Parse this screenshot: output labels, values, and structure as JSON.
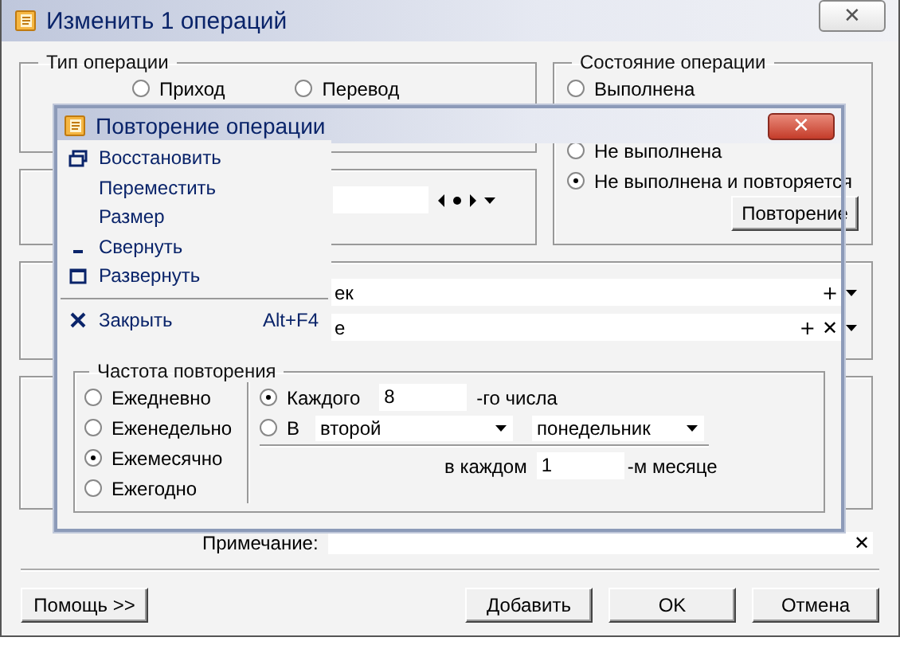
{
  "main_window": {
    "title": "Изменить 1 операций",
    "close": "✕",
    "operation_type": {
      "title": "Тип операции",
      "options": [
        {
          "label": "Приход",
          "selected": false
        },
        {
          "label": "Перевод",
          "selected": false
        }
      ]
    },
    "operation_state": {
      "title": "Состояние операции",
      "options": [
        {
          "label": "Выполнена",
          "selected": false
        },
        {
          "label": "Не выполнена",
          "selected": false
        },
        {
          "label": "Не выполнена и повторяется",
          "selected": true
        }
      ],
      "button": "Повторение"
    },
    "fields": [
      {
        "value": "ек",
        "buttons": [
          "+"
        ]
      },
      {
        "value": "е",
        "buttons": [
          "+",
          "✕"
        ]
      }
    ],
    "note": {
      "label": "Примечание:",
      "clear": "✕"
    },
    "buttons": [
      "Помощь >>",
      "Добавить",
      "OK",
      "Отмена"
    ]
  },
  "repeat_dialog": {
    "title": "Повторение операции",
    "close": "✕",
    "system_menu": [
      {
        "kind": "restore",
        "label": "Восстановить"
      },
      {
        "kind": "move",
        "label": "Переместить"
      },
      {
        "kind": "size",
        "label": "Размер"
      },
      {
        "kind": "minimize",
        "label": "Свернуть"
      },
      {
        "kind": "maximize",
        "label": "Развернуть"
      },
      {
        "kind": "separator"
      },
      {
        "kind": "close",
        "label": "Закрыть",
        "shortcut": "Alt+F4"
      }
    ],
    "frequency": {
      "title": "Частота повторения",
      "periods": [
        {
          "label": "Ежедневно",
          "selected": false
        },
        {
          "label": "Еженедельно",
          "selected": false
        },
        {
          "label": "Ежемесячно",
          "selected": true
        },
        {
          "label": "Ежегодно",
          "selected": false
        }
      ],
      "day_option": {
        "selected": true,
        "label": "Каждого",
        "value": "8",
        "suffix": "-го числа"
      },
      "weekday_option": {
        "selected": false,
        "label": "В",
        "ordinal": "второй",
        "weekday": "понедельник"
      },
      "interval": {
        "label": "в каждом",
        "value": "1",
        "suffix": "-м месяце"
      }
    }
  }
}
